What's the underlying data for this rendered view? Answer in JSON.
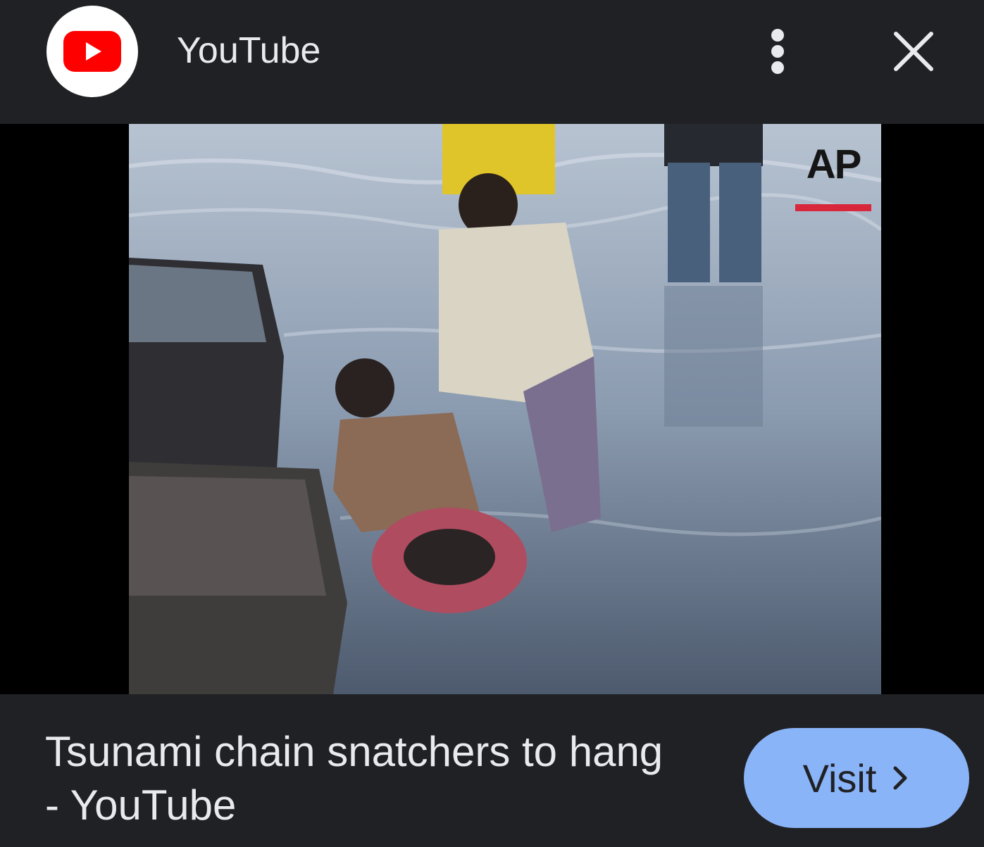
{
  "header": {
    "site_name": "YouTube",
    "logo_icon": "youtube-play-icon",
    "menu_icon": "more-vert-icon",
    "close_icon": "close-icon"
  },
  "media": {
    "watermark": "AP",
    "description_icon": "video-thumbnail"
  },
  "footer": {
    "title": "Tsunami chain snatchers to hang - YouTube",
    "visit_label": "Visit",
    "visit_icon": "chevron-right-icon"
  },
  "colors": {
    "background": "#202124",
    "text": "#e8eaed",
    "accent": "#8ab4f8",
    "youtube_red": "#ff0000"
  }
}
